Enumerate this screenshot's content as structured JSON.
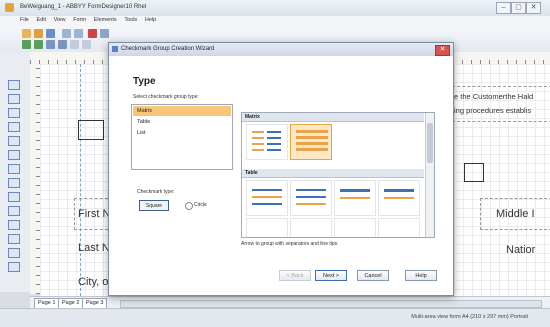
{
  "window": {
    "title": "BeWeiguang_1 - ABBYY FormDesigner10 Rhel",
    "controls": [
      "–",
      "▢",
      "✕"
    ]
  },
  "menu": [
    "File",
    "Edit",
    "View",
    "Form",
    "Elements",
    "Tools",
    "Help"
  ],
  "canvas_texts": {
    "right_header_1": "e the Customerthe Hald",
    "right_header_2": "ing procedures establis",
    "first_name": "First N",
    "last_name": "Last N",
    "city": "City, o",
    "middle": "Middle I",
    "nation": "Natior"
  },
  "page_tabs": [
    "Page 1",
    "Page 2",
    "Page 3"
  ],
  "status": "Multi-area view form A4 (210 x 297 mm) Portrait",
  "dialog": {
    "title": "Checkmark Group Creation Wizard",
    "heading": "Type",
    "prompt": "Select checkmark group type:",
    "types": [
      "Matrix",
      "Table",
      "List"
    ],
    "selected_type": 0,
    "checkmark_type_label": "Checkmark type:",
    "checkmark_square": "Square",
    "checkmark_circle": "Circle",
    "gallery_sections": [
      "Matrix",
      "Table"
    ],
    "description": "Arrow to group with separators and line tips.",
    "buttons": {
      "back": "< Back",
      "next": "Next >",
      "cancel": "Cancel",
      "help": "Help"
    }
  },
  "colors": {
    "selection": "#f7c779",
    "accent_blue": "#3f6fb5",
    "orange": "#e9a34b"
  }
}
